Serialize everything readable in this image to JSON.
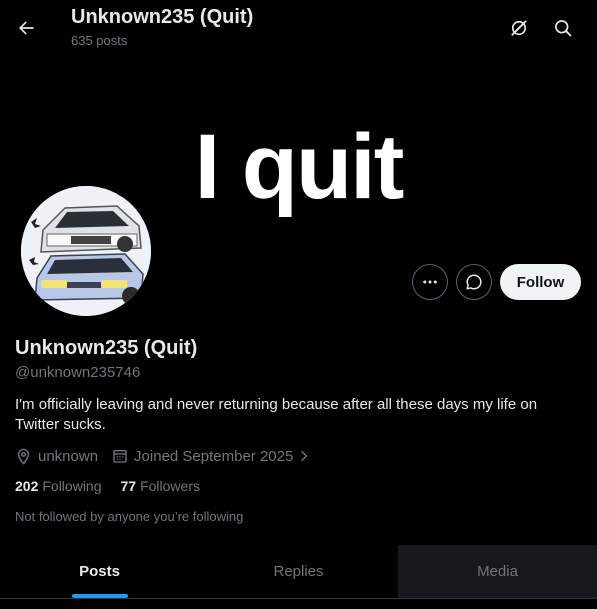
{
  "header": {
    "title": "Unknown235 (Quit)",
    "posts_count": "635 posts"
  },
  "banner": {
    "text": "I quit"
  },
  "profile": {
    "display_name": "Unknown235 (Quit)",
    "handle": "@unknown235746",
    "bio": "I'm officially leaving and never returning because after all these days my life on Twitter sucks.",
    "location": "unknown",
    "joined": "Joined September 2025",
    "following_count": "202",
    "following_label": "Following",
    "followers_count": "77",
    "followers_label": "Followers",
    "not_followed_text": "Not followed by anyone you’re following"
  },
  "actions": {
    "follow_label": "Follow"
  },
  "tabs": [
    {
      "label": "Posts",
      "active": true
    },
    {
      "label": "Replies",
      "active": false
    },
    {
      "label": "Media",
      "active": false
    }
  ],
  "icons": {
    "back": "arrow-left-icon",
    "grok": "grok-icon",
    "search": "search-icon",
    "more": "more-icon",
    "message": "message-icon",
    "location": "location-icon",
    "calendar": "calendar-icon",
    "chevron": "chevron-right-icon"
  },
  "colors": {
    "background": "#000000",
    "text_primary": "#e7e9ea",
    "text_secondary": "#71767b",
    "accent": "#1d9bf0",
    "follow_bg": "#eff3f4"
  }
}
